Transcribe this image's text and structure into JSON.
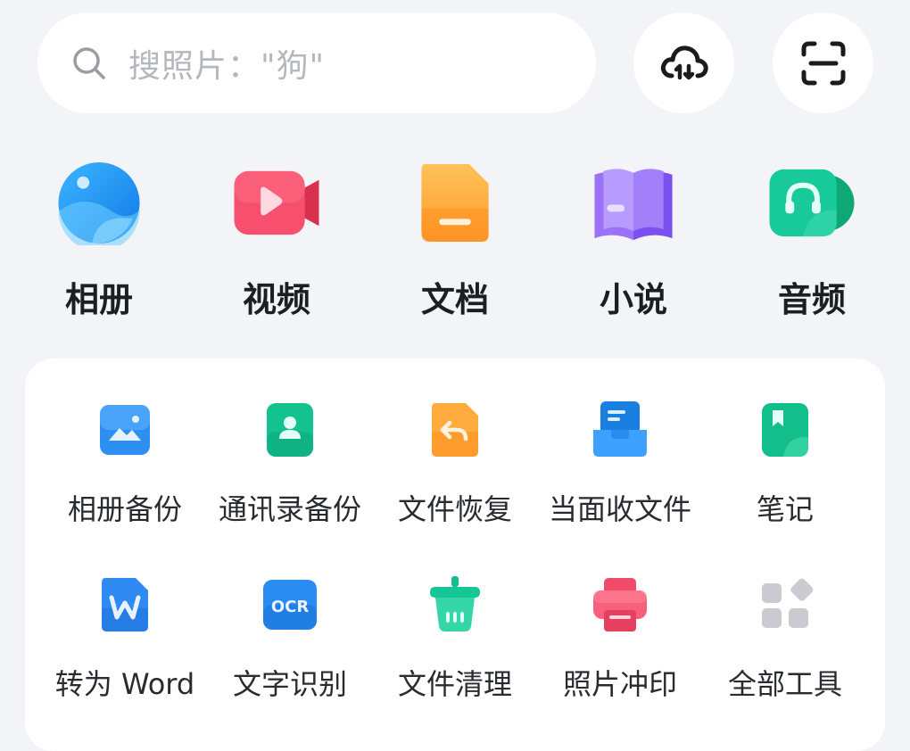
{
  "search": {
    "placeholder": "搜照片：\"狗\""
  },
  "header_buttons": [
    {
      "icon": "cloud-sync-icon"
    },
    {
      "icon": "scan-icon"
    }
  ],
  "categories": [
    {
      "label": "相册",
      "icon": "album-icon",
      "color": "#1e9bf0"
    },
    {
      "label": "视频",
      "icon": "video-icon",
      "color": "#f2466a"
    },
    {
      "label": "文档",
      "icon": "document-icon",
      "color": "#ffa43a"
    },
    {
      "label": "小说",
      "icon": "novel-icon",
      "color": "#8a5cf2"
    },
    {
      "label": "音频",
      "icon": "audio-icon",
      "color": "#14c48f"
    }
  ],
  "tools": [
    {
      "label": "相册备份",
      "icon": "photo-backup-icon"
    },
    {
      "label": "通讯录备份",
      "icon": "contacts-backup-icon"
    },
    {
      "label": "文件恢复",
      "icon": "file-restore-icon"
    },
    {
      "label": "当面收文件",
      "icon": "receive-files-icon"
    },
    {
      "label": "笔记",
      "icon": "notes-icon"
    },
    {
      "label": "转为 Word",
      "icon": "word-convert-icon"
    },
    {
      "label": "文字识别",
      "icon": "ocr-icon",
      "icon_text": "OCR"
    },
    {
      "label": "文件清理",
      "icon": "file-clean-icon"
    },
    {
      "label": "照片冲印",
      "icon": "photo-print-icon"
    },
    {
      "label": "全部工具",
      "icon": "all-tools-icon"
    }
  ]
}
